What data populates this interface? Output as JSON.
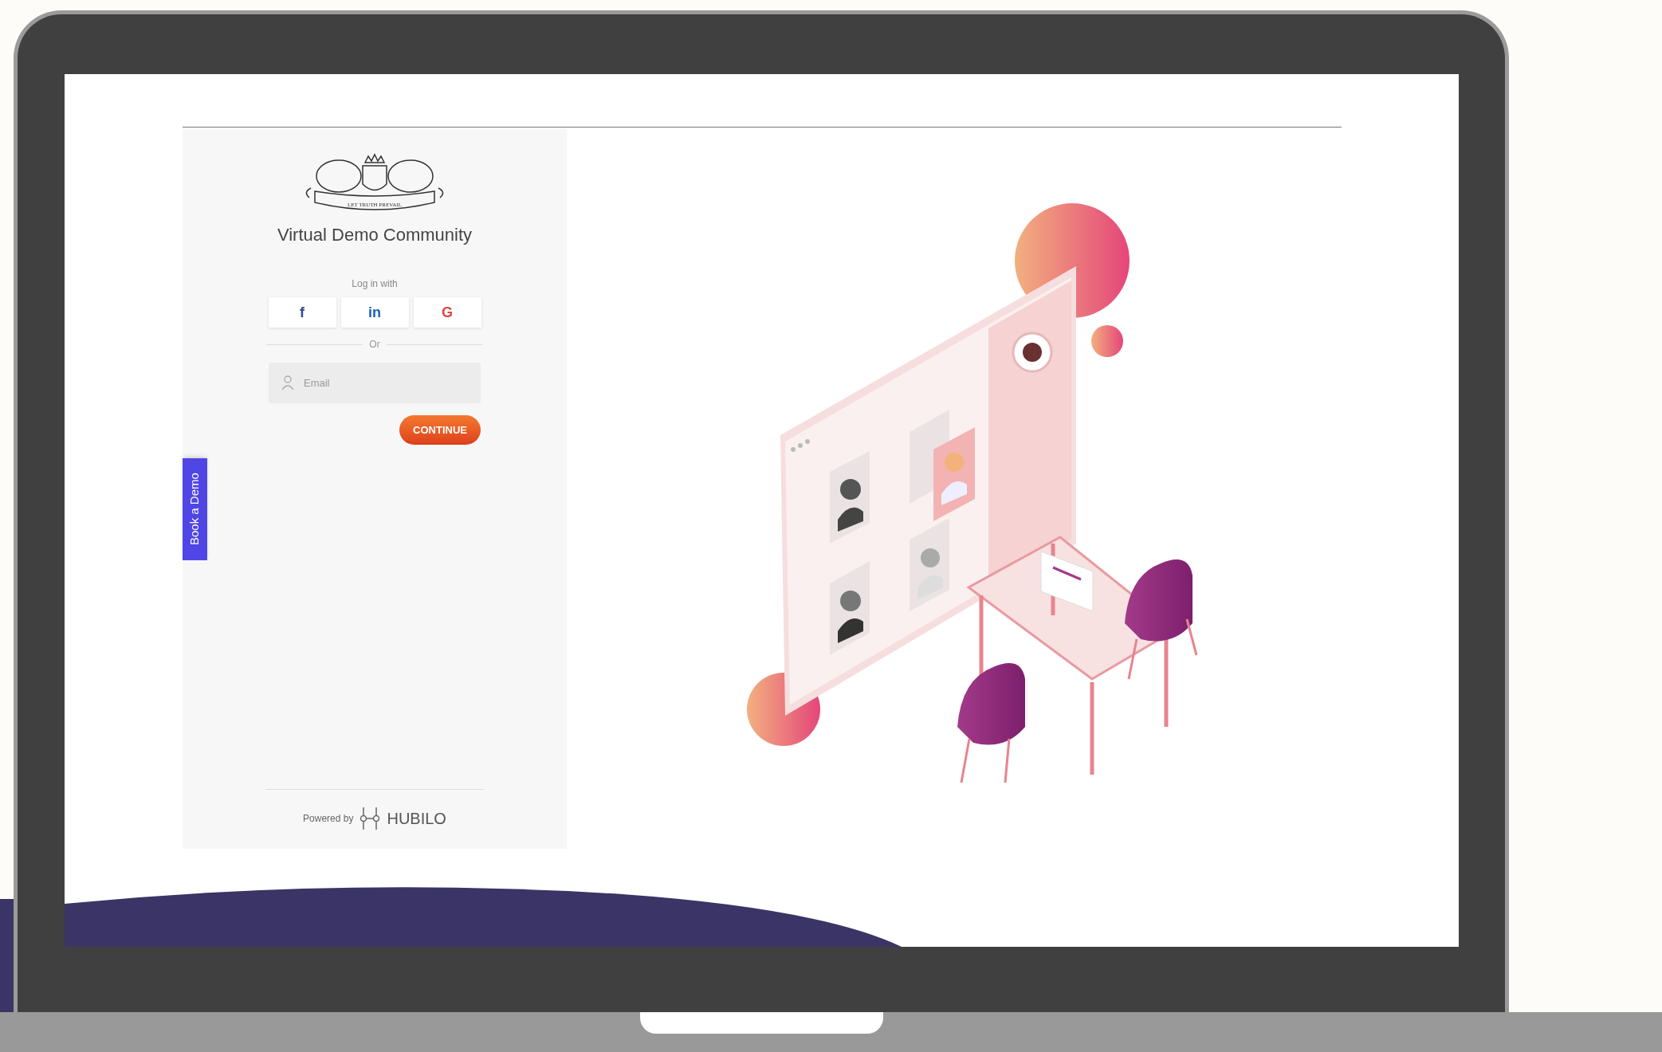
{
  "login_panel": {
    "logo_motto": "LET TRUTH PREVAIL",
    "title": "Virtual Demo Community",
    "social_label": "Log in with",
    "social_buttons": [
      {
        "kind": "facebook",
        "label": "f"
      },
      {
        "kind": "linkedin",
        "label": "in"
      },
      {
        "kind": "google",
        "label": "G"
      }
    ],
    "divider_text": "Or",
    "email_field": {
      "placeholder": "Email"
    },
    "continue_button": "CONTINUE",
    "book_demo_tab": "Book a Demo",
    "footer": {
      "powered_by": "Powered by",
      "brand": "HUBILO"
    }
  }
}
